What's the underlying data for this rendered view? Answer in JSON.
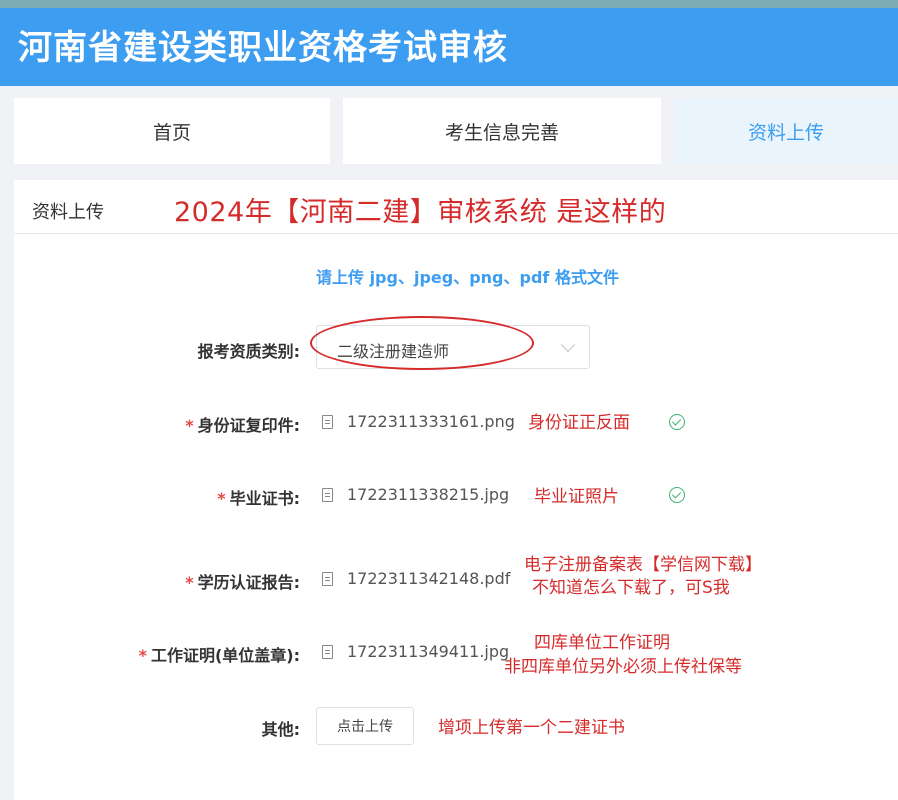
{
  "header": {
    "title": "河南省建设类职业资格考试审核"
  },
  "tabs": [
    {
      "label": "首页"
    },
    {
      "label": "考生信息完善"
    },
    {
      "label": "资料上传"
    }
  ],
  "panel": {
    "title": "资料上传",
    "hint": "请上传 jpg、jpeg、png、pdf 格式文件"
  },
  "form": {
    "qualification": {
      "label": "报考资质类别:",
      "value": "二级注册建造师"
    },
    "id_card": {
      "label": "身份证复印件:",
      "file": "1722311333161.png"
    },
    "diploma": {
      "label": "毕业证书:",
      "file": "1722311338215.jpg"
    },
    "degree_report": {
      "label": "学历认证报告:",
      "file": "1722311342148.pdf"
    },
    "work_proof": {
      "label": "工作证明(单位盖章):",
      "file": "1722311349411.jpg"
    },
    "other": {
      "label": "其他:",
      "button": "点击上传"
    },
    "required_mark": "*"
  },
  "annotations": {
    "headline": "2024年【河南二建】审核系统 是这样的",
    "id_card": "身份证正反面",
    "diploma": "毕业证照片",
    "degree_line1": "电子注册备案表【学信网下载】",
    "degree_line2": "不知道怎么下载了，可S我",
    "work_line1": "四库单位工作证明",
    "work_line2": "非四库单位另外必须上传社保等",
    "other": "增项上传第一个二建证书"
  },
  "colors": {
    "accent": "#3d9df0",
    "annotation": "#d62b2b",
    "required": "#e84545",
    "success": "#3bb36b"
  }
}
